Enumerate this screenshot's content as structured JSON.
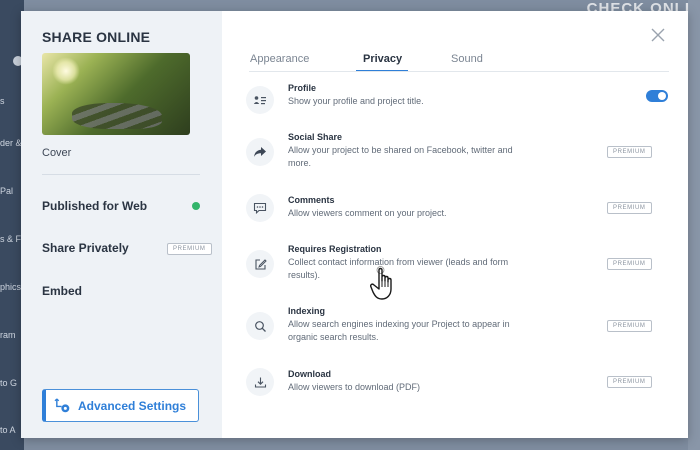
{
  "background": {
    "top_text": "CHECK ONLI",
    "sidebar_fragments": [
      "s",
      "der &",
      "Pal",
      "s & F",
      "phics",
      "ram",
      "to G",
      "to A"
    ]
  },
  "modal": {
    "title": "SHARE ONLINE",
    "cover_label": "Cover",
    "menu": {
      "published": "Published for Web",
      "share_privately": "Share Privately",
      "embed": "Embed"
    },
    "premium_label": "PREMIUM",
    "advanced_settings": "Advanced Settings",
    "tabs": [
      {
        "label": "Appearance"
      },
      {
        "label": "Privacy"
      },
      {
        "label": "Sound"
      }
    ],
    "settings": [
      {
        "title": "Profile",
        "desc": "Show your profile and project title.",
        "icon": "profile-card-icon"
      },
      {
        "title": "Social Share",
        "desc": "Allow your project to be shared on Facebook, twitter and more.",
        "icon": "share-arrow-icon"
      },
      {
        "title": "Comments",
        "desc": "Allow viewers comment on your project.",
        "icon": "comment-icon"
      },
      {
        "title": "Requires Registration",
        "desc": "Collect contact information from viewer (leads and form results).",
        "icon": "edit-icon"
      },
      {
        "title": "Indexing",
        "desc": "Allow search engines indexing your Project to appear in organic search results.",
        "icon": "search-icon"
      },
      {
        "title": "Download",
        "desc": "Allow viewers to download (PDF)",
        "icon": "download-icon"
      }
    ],
    "colors": {
      "accent": "#2f7fd8",
      "status_green": "#33b56b"
    }
  }
}
